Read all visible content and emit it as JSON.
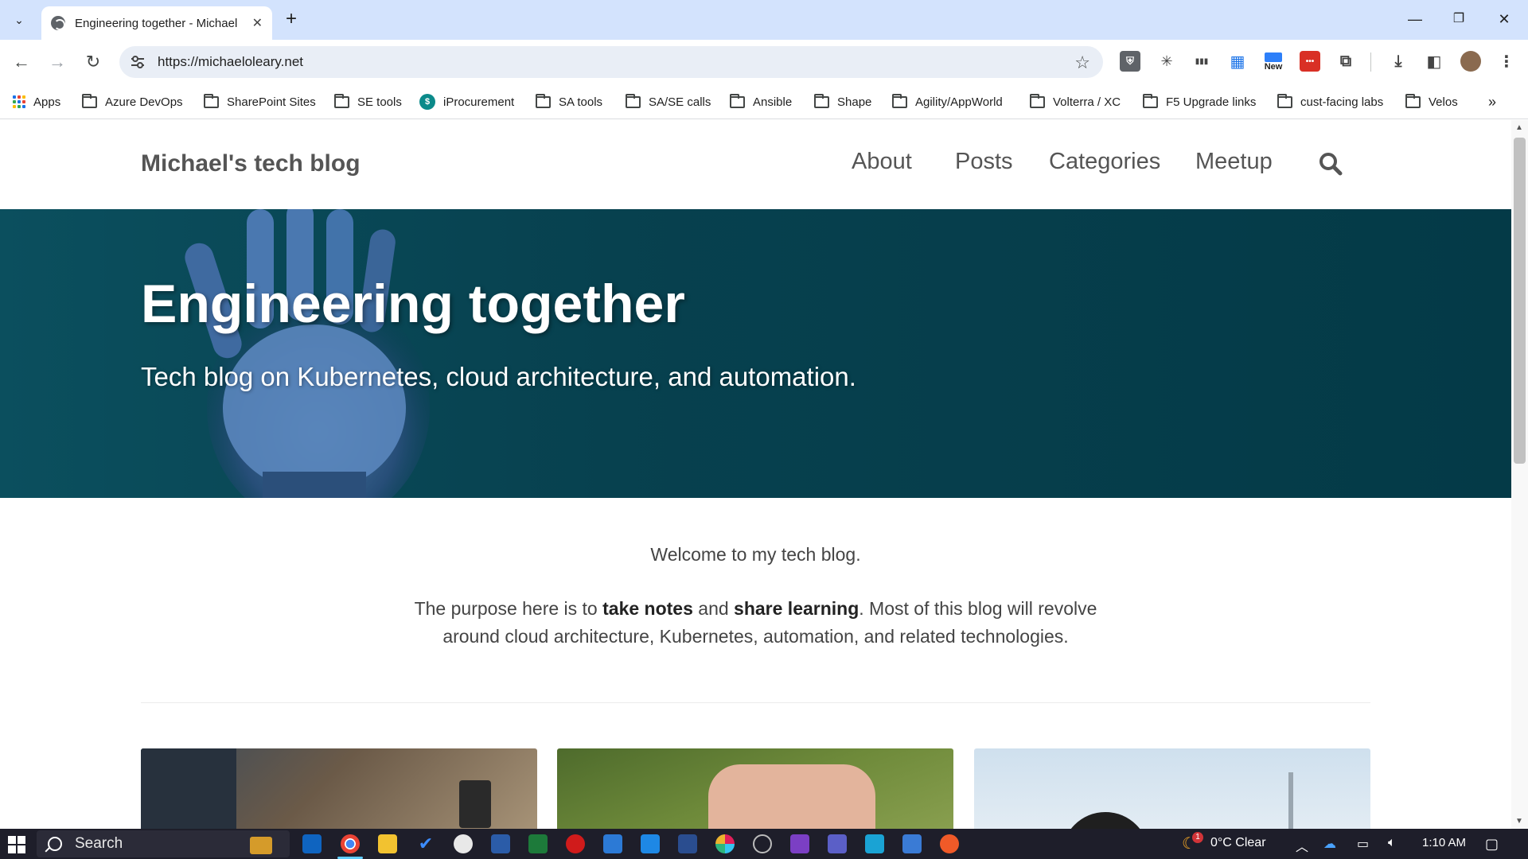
{
  "browser": {
    "tab_title": "Engineering together - Michael",
    "url": "https://michaeloleary.net",
    "bookmarks": [
      {
        "label": "Apps"
      },
      {
        "label": "Azure DevOps"
      },
      {
        "label": "SharePoint Sites"
      },
      {
        "label": "SE tools"
      },
      {
        "label": "iProcurement"
      },
      {
        "label": "SA tools"
      },
      {
        "label": "SA/SE calls"
      },
      {
        "label": "Ansible"
      },
      {
        "label": "Shape"
      },
      {
        "label": "Agility/AppWorld"
      },
      {
        "label": "Volterra / XC"
      },
      {
        "label": "F5 Upgrade links"
      },
      {
        "label": "cust-facing labs"
      },
      {
        "label": "Velos"
      }
    ],
    "extension_new_label": "New"
  },
  "site": {
    "title": "Michael's tech blog",
    "nav": [
      "About",
      "Posts",
      "Categories",
      "Meetup"
    ]
  },
  "hero": {
    "title": "Engineering together",
    "subtitle": "Tech blog on Kubernetes, cloud architecture, and automation."
  },
  "intro": {
    "welcome": "Welcome to my tech blog.",
    "p_before": "The purpose here is to ",
    "b1": "take notes",
    "p_mid": " and ",
    "b2": "share learning",
    "p_after": ". Most of this blog will revolve",
    "line2": "around cloud architecture, Kubernetes, automation, and related technologies."
  },
  "taskbar": {
    "search_label": "Search",
    "weather": "0°C  Clear",
    "weather_badge": "1",
    "time": "1:10 AM"
  },
  "colors": {
    "hero_bg": "#07414f",
    "tabstrip": "#d3e3fd",
    "taskbar": "#1e1e2a"
  }
}
